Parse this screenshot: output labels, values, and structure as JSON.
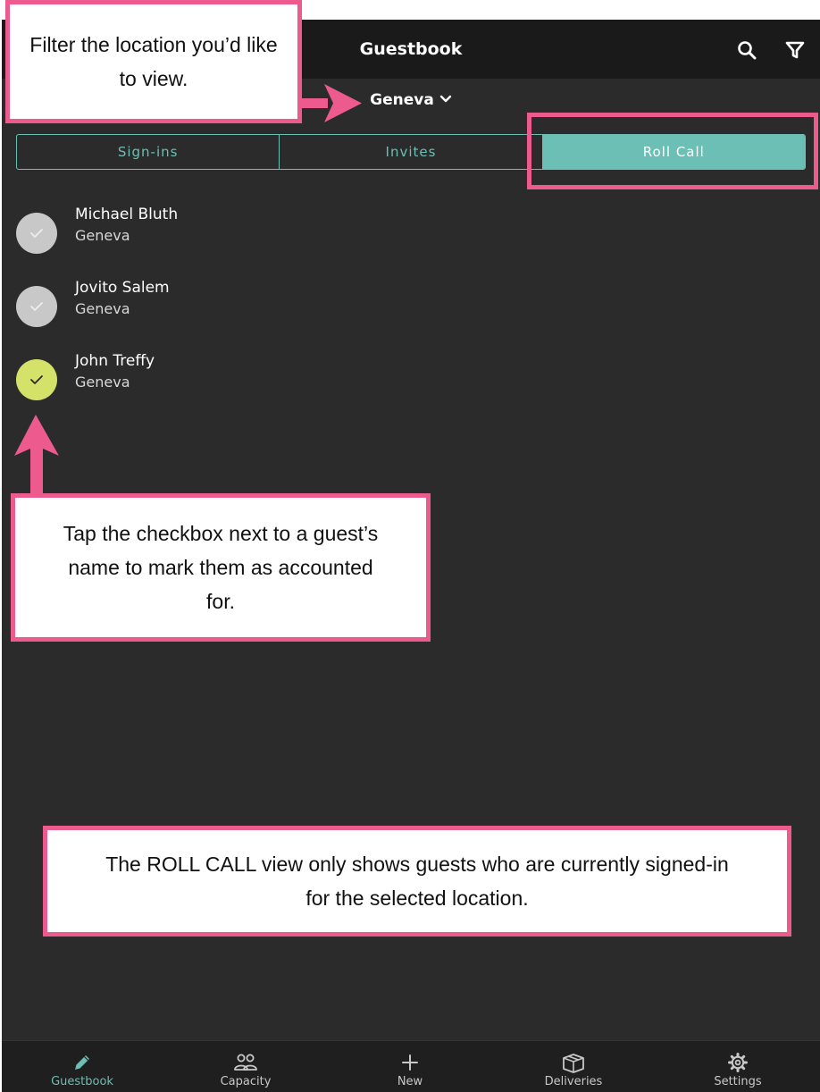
{
  "app": {
    "title": "Guestbook",
    "location": "Geneva",
    "accent_color": "#6bbfb5",
    "checked_color": "#d4e26a",
    "annotation_color": "#ec5a8e"
  },
  "header_icons": [
    "search-icon",
    "filter-icon"
  ],
  "tabs": [
    {
      "label": "Sign-ins",
      "active": false
    },
    {
      "label": "Invites",
      "active": false
    },
    {
      "label": "Roll Call",
      "active": true
    }
  ],
  "guests": [
    {
      "name": "Michael Bluth",
      "location": "Geneva",
      "checked": false
    },
    {
      "name": "Jovito Salem",
      "location": "Geneva",
      "checked": false
    },
    {
      "name": "John Treffy",
      "location": "Geneva",
      "checked": true
    }
  ],
  "bottom_nav": [
    {
      "label": "Guestbook",
      "icon": "pencil-icon",
      "active": true
    },
    {
      "label": "Capacity",
      "icon": "people-icon",
      "active": false
    },
    {
      "label": "New",
      "icon": "plus-icon",
      "active": false
    },
    {
      "label": "Deliveries",
      "icon": "package-icon",
      "active": false
    },
    {
      "label": "Settings",
      "icon": "gear-icon",
      "active": false
    }
  ],
  "callouts": {
    "filter": "Filter the location you’d like to view.",
    "checkbox": "Tap the checkbox next to a guest’s name to mark them as accounted for.",
    "rollcall": "The ROLL CALL view only shows guests who are currently signed-in for the selected location."
  }
}
